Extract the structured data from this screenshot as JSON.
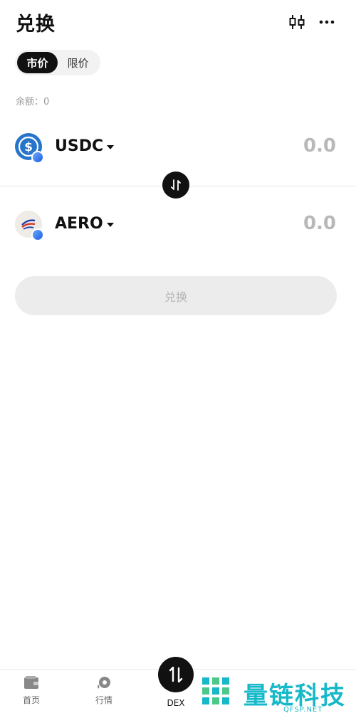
{
  "header": {
    "title": "兑换",
    "chart_icon": "candlestick-chart-icon",
    "more_icon": "more-dots-icon"
  },
  "order_type": {
    "tabs": [
      {
        "label": "市价",
        "active": true
      },
      {
        "label": "限价",
        "active": false
      }
    ]
  },
  "balance": {
    "label": "余额：",
    "value": "0"
  },
  "from_token": {
    "symbol": "USDC",
    "amount_placeholder": "0.0",
    "icon": "usdc-token-icon",
    "icon_color": "#2775ca"
  },
  "to_token": {
    "symbol": "AERO",
    "amount_placeholder": "0.0",
    "icon": "aero-token-icon"
  },
  "swap_button": {
    "label": "兑换"
  },
  "bottom_nav": {
    "items": [
      {
        "label": "首页",
        "icon": "wallet-icon"
      },
      {
        "label": "行情",
        "icon": "market-icon"
      },
      {
        "label": "DEX",
        "icon": "swap-arrows-icon"
      }
    ]
  },
  "watermark": {
    "text": "量链科技",
    "sub": "QFSP.NET"
  },
  "colors": {
    "primary": "#111111",
    "muted": "#b8b8b8",
    "watermark": "#17b8c8"
  }
}
